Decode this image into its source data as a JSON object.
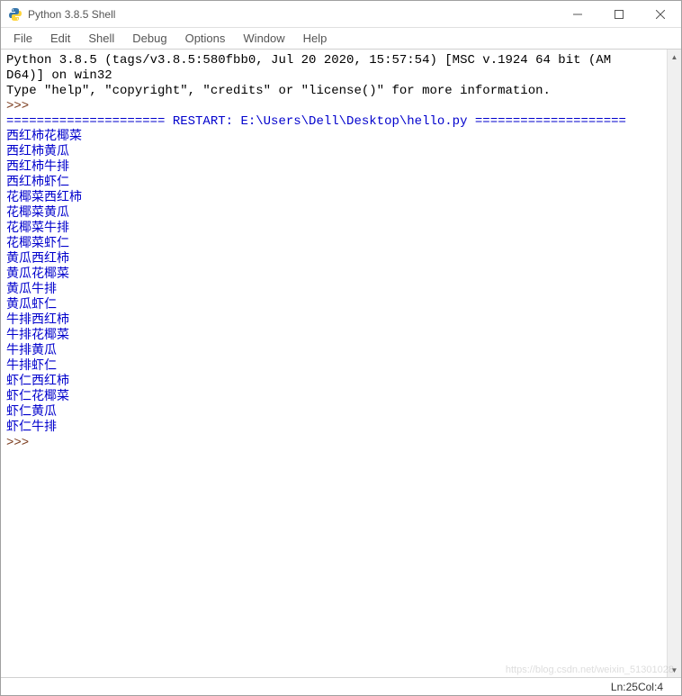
{
  "window": {
    "title": "Python 3.8.5 Shell"
  },
  "menu": {
    "file": "File",
    "edit": "Edit",
    "shell": "Shell",
    "debug": "Debug",
    "options": "Options",
    "window": "Window",
    "help": "Help"
  },
  "shell": {
    "banner_line1": "Python 3.8.5 (tags/v3.8.5:580fbb0, Jul 20 2020, 15:57:54) [MSC v.1924 64 bit (AM",
    "banner_line2": "D64)] on win32",
    "banner_line3": "Type \"help\", \"copyright\", \"credits\" or \"license()\" for more information.",
    "prompt1": ">>> ",
    "restart_line": "===================== RESTART: E:\\Users\\Dell\\Desktop\\hello.py ====================",
    "output": [
      "西红柿花椰菜",
      "西红柿黄瓜",
      "西红柿牛排",
      "西红柿虾仁",
      "花椰菜西红柿",
      "花椰菜黄瓜",
      "花椰菜牛排",
      "花椰菜虾仁",
      "黄瓜西红柿",
      "黄瓜花椰菜",
      "黄瓜牛排",
      "黄瓜虾仁",
      "牛排西红柿",
      "牛排花椰菜",
      "牛排黄瓜",
      "牛排虾仁",
      "虾仁西红柿",
      "虾仁花椰菜",
      "虾仁黄瓜",
      "虾仁牛排"
    ],
    "prompt2": ">>> "
  },
  "status": {
    "ln_label": "Ln: ",
    "ln_value": "25",
    "col_label": "  Col: ",
    "col_value": "4"
  },
  "watermark": "https://blog.csdn.net/weixin_51301028"
}
